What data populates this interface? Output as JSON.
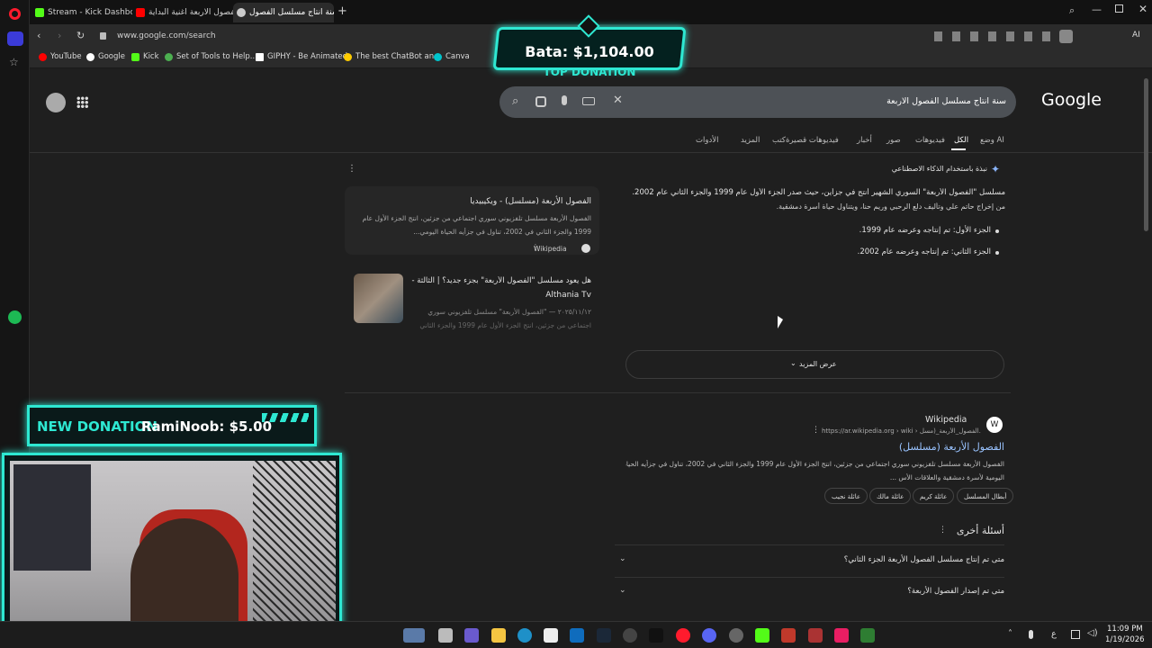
{
  "tabs": [
    {
      "label": "Stream - Kick Dashboard",
      "color": "#53fc18"
    },
    {
      "label": "الفصول الاربعة اغنية البداية",
      "color": "#ff0000"
    },
    {
      "label": "سنة انتاج مسلسل الفصول",
      "color": "#cccccc"
    }
  ],
  "address": {
    "url": "www.google.com/search"
  },
  "bookmarks": [
    {
      "label": "YouTube",
      "color": "#ff0000"
    },
    {
      "label": "Google",
      "color": "#ffffff"
    },
    {
      "label": "Kick",
      "color": "#53fc18"
    },
    {
      "label": "Set of Tools to Help...",
      "color": "#4caf50"
    },
    {
      "label": "GIPHY - Be Animated",
      "color": "#ffffff"
    },
    {
      "label": "The best ChatBot an...",
      "color": "#ffcc00"
    },
    {
      "label": "Canva",
      "color": "#00c4cc"
    }
  ],
  "donation_top": {
    "amount": "Bata: $1,104.00",
    "label": "TOP DONATION"
  },
  "donation_new": {
    "label": "NEW DONATION",
    "name": "RamiNoob: $5.00"
  },
  "google": {
    "logo": "Google",
    "query": "سنة انتاج مسلسل الفصول الاربعة",
    "nav": [
      "وضع AI",
      "الكل",
      "فيديوهات",
      "صور",
      "أخبار",
      "فيديوهات قصيرة",
      "كتب",
      "المزيد",
      "الأدوات"
    ],
    "ai_header": "نبذة باستخدام الذكاء الاصطناعي",
    "ai_line1": "مسلسل \"الفصول الأربعة\" السوري الشهير أُنتج في جزأين، حيث صدر الجزء الأول عام 1999 والجزء الثاني عام 2002.",
    "ai_line2": "من إخراج حاتم علي وتأليف دلع الرحبي وريم حنا، ويتناول حياة أسرة دمشقية.",
    "bullet1": "الجزء الأول: تم إنتاجه وعرضه عام 1999.",
    "bullet2": "الجزء الثاني: تم إنتاجه وعرضه عام 2002.",
    "card1_title": "الفصول الأربعة (مسلسل) - ويكيبيديا",
    "card1_body1": "الفصول الأربعة مسلسل تلفزيوني سوري اجتماعي من جزئين، انتج الجزء الأول عام",
    "card1_body2": "1999 والجزء الثاني في 2002، تناول في جزأيه الحياة اليومي...",
    "card1_source": "Wikipedia",
    "card2_title1": "هل يعود مسلسل \"الفصول الأربعة\" بجزء جديد؟ | الثالثة -",
    "card2_title2": "Althania Tv",
    "card2_body1": "٢٠٢٥/١١/١٢ — \"الفصول الأربعة\" مسلسل تلفزيوني سوري",
    "card2_body2": "اجتماعي من جزئين، انتج الجزء الأول عام 1999 والجزء الثاني",
    "show_more": "عرض المزيد",
    "result_site": "Wikipedia",
    "result_url": "https://ar.wikipedia.org › wiki › الفصول_الأربعة_(مسل...",
    "result_title": "الفصول الأربعة (مسلسل)",
    "result_body1": "الفصول الأربعة مسلسل تلفزيوني سوري اجتماعي من جزئين، انتج الجزء الأول عام 1999 والجزء الثاني في 2002، تناول في جزأيه الحياة",
    "result_body2": "اليومية لأسرة دمشقية والعلاقات الأس ...",
    "chips": [
      "أبطال المسلسل",
      "عائلة كريم",
      "عائلة مالك",
      "عائلة نجيب"
    ],
    "paa_title": "أسئلة أخرى",
    "paa": [
      "متى تم إنتاج مسلسل الفصول الأربعة الجزء الثاني؟",
      "متى تم إصدار الفصول الأربعة؟"
    ]
  },
  "taskbar": {
    "time": "11:09 PM",
    "date": "1/19/2026",
    "lang": "ع"
  }
}
